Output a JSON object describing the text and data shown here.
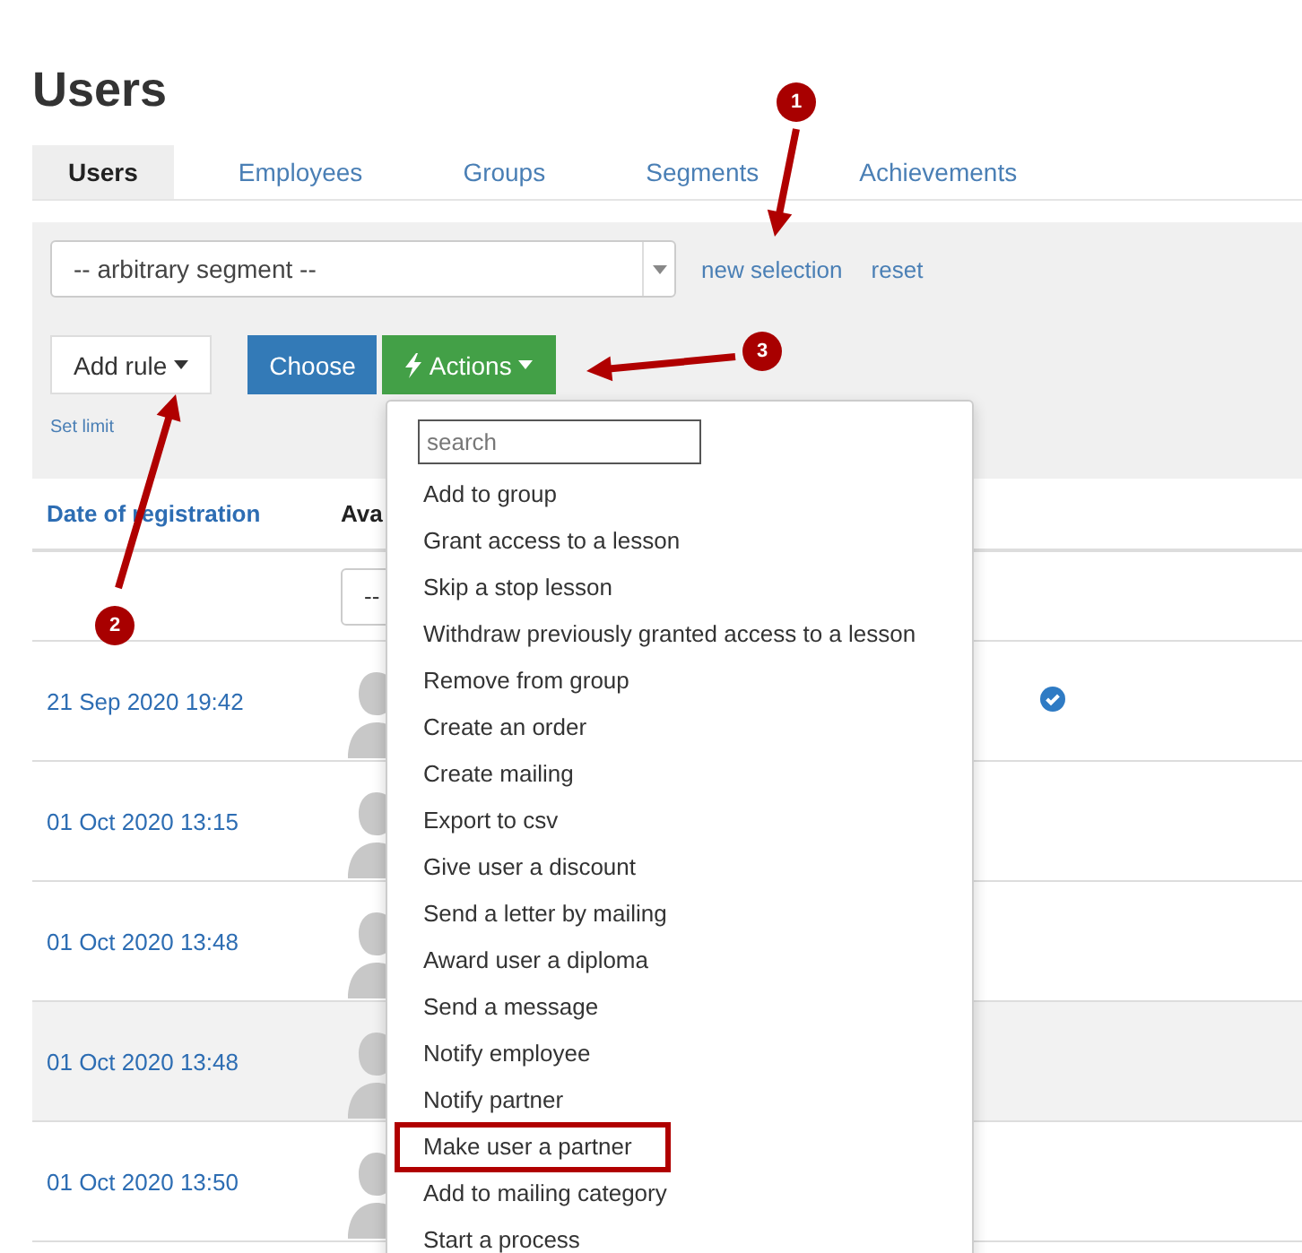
{
  "page": {
    "title": "Users"
  },
  "tabs": [
    {
      "label": "Users",
      "selected": true
    },
    {
      "label": "Employees",
      "selected": false
    },
    {
      "label": "Groups",
      "selected": false
    },
    {
      "label": "Segments",
      "selected": false
    },
    {
      "label": "Achievements",
      "selected": false
    }
  ],
  "segment_select": {
    "value": "-- arbitrary segment --"
  },
  "links": [
    "new selection",
    "reset"
  ],
  "buttons": {
    "add_rule": "Add rule",
    "choose": "Choose",
    "actions": "Actions"
  },
  "set_limit": "Set limit",
  "table": {
    "columns": [
      "Date of registration",
      "Ava"
    ],
    "filter_value": "--",
    "rows": [
      {
        "date": "21 Sep 2020 19:42",
        "verified": true,
        "shaded": false
      },
      {
        "date": "01 Oct 2020 13:15",
        "verified": false,
        "shaded": false
      },
      {
        "date": "01 Oct 2020 13:48",
        "verified": false,
        "shaded": false
      },
      {
        "date": "01 Oct 2020 13:48",
        "verified": false,
        "shaded": true
      },
      {
        "date": "01 Oct 2020 13:50",
        "verified": false,
        "shaded": false
      }
    ]
  },
  "actions_menu": {
    "placeholder": "search",
    "items": [
      {
        "label": "Add to group",
        "highlighted": false
      },
      {
        "label": "Grant access to a lesson",
        "highlighted": false
      },
      {
        "label": "Skip a stop lesson",
        "highlighted": false
      },
      {
        "label": "Withdraw previously granted access to a lesson",
        "highlighted": false
      },
      {
        "label": "Remove from group",
        "highlighted": false
      },
      {
        "label": "Create an order",
        "highlighted": false
      },
      {
        "label": "Create mailing",
        "highlighted": false
      },
      {
        "label": "Export to csv",
        "highlighted": false
      },
      {
        "label": "Give user a discount",
        "highlighted": false
      },
      {
        "label": "Send a letter by mailing",
        "highlighted": false
      },
      {
        "label": "Award user a diploma",
        "highlighted": false
      },
      {
        "label": "Send a message",
        "highlighted": false
      },
      {
        "label": "Notify employee",
        "highlighted": false
      },
      {
        "label": "Notify partner",
        "highlighted": false
      },
      {
        "label": "Make user a partner",
        "highlighted": true
      },
      {
        "label": "Add to mailing category",
        "highlighted": false
      },
      {
        "label": "Start a process",
        "highlighted": false
      }
    ]
  },
  "annotations": [
    {
      "number": "1"
    },
    {
      "number": "2"
    },
    {
      "number": "3"
    }
  ]
}
